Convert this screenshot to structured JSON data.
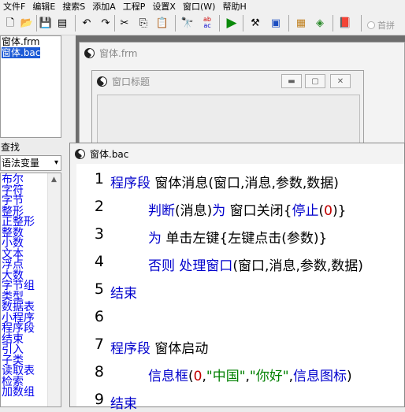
{
  "menu": [
    "文件F",
    "编辑E",
    "搜索S",
    "添加A",
    "工程P",
    "设置X",
    "窗口(W)",
    "帮助H"
  ],
  "toolbar": {
    "icons": [
      "new-file-icon",
      "open-folder-icon",
      "save-icon",
      "save-all-icon",
      "undo-icon",
      "redo-icon",
      "cut-icon",
      "copy-icon",
      "paste-icon",
      "find-icon",
      "replace-icon",
      "run-icon",
      "tools-icon",
      "form-icon",
      "colors-icon",
      "package-icon",
      "book-icon"
    ],
    "radio_label": "首拼"
  },
  "files": [
    "窗体.frm",
    "窗体.bac"
  ],
  "search_label": "查找",
  "syntax_select": "语法变量",
  "keywords": [
    "布尔",
    "字符",
    "字节",
    "整形",
    "正整形",
    "整数",
    "小数",
    "文本",
    "浮点",
    "大数",
    "字节组",
    "类型",
    "数据表",
    "小程序",
    "程序段",
    "结束",
    "引入",
    "子类",
    "读取表",
    "检索",
    "加数组"
  ],
  "form_window": {
    "title": "窗体.frm"
  },
  "inner_window": {
    "title": "窗口标题"
  },
  "code_window": {
    "title": "窗体.bac",
    "line_numbers": [
      "1",
      "2",
      "3",
      "4",
      "5",
      "6",
      "7",
      "8",
      "9"
    ],
    "lines": [
      [
        {
          "t": "程序段",
          "c": "k"
        },
        {
          "t": " 窗体消息(窗口,消息,参数,数据)",
          "c": ""
        }
      ],
      [
        {
          "t": "判断",
          "c": "k"
        },
        {
          "t": "(消息)",
          "c": ""
        },
        {
          "t": "为",
          "c": "k"
        },
        {
          "t": " 窗口关闭{",
          "c": ""
        },
        {
          "t": "停止",
          "c": "k"
        },
        {
          "t": "(",
          "c": ""
        },
        {
          "t": "0",
          "c": "s"
        },
        {
          "t": ")}",
          "c": ""
        }
      ],
      [
        {
          "t": "为",
          "c": "k"
        },
        {
          "t": " 单击左键{左键点击(参数)}",
          "c": ""
        }
      ],
      [
        {
          "t": "否则",
          "c": "k"
        },
        {
          "t": " ",
          "c": ""
        },
        {
          "t": "处理窗口",
          "c": "k"
        },
        {
          "t": "(窗口,消息,参数,数据)",
          "c": ""
        }
      ],
      [
        {
          "t": "结束",
          "c": "k"
        }
      ],
      [],
      [
        {
          "t": "程序段",
          "c": "k"
        },
        {
          "t": " 窗体启动",
          "c": ""
        }
      ],
      [
        {
          "t": "信息框",
          "c": "k"
        },
        {
          "t": "(",
          "c": ""
        },
        {
          "t": "0",
          "c": "s"
        },
        {
          "t": ",",
          "c": ""
        },
        {
          "t": "\"中国\"",
          "c": "g"
        },
        {
          "t": ",",
          "c": ""
        },
        {
          "t": "\"你好\"",
          "c": "g"
        },
        {
          "t": ",",
          "c": ""
        },
        {
          "t": "信息图标",
          "c": "k"
        },
        {
          "t": ")",
          "c": ""
        }
      ],
      [
        {
          "t": "结束",
          "c": "k"
        }
      ]
    ]
  }
}
